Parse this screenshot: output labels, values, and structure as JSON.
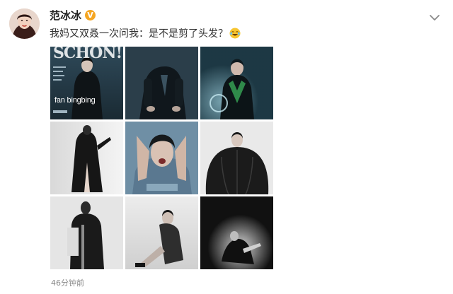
{
  "post": {
    "username": "范冰冰",
    "verified_badge": "V",
    "text": "我妈又双叒一次问我：是不是剪了头发？",
    "emoji_icon": "laughing-tears-emoji",
    "timestamp": "46分钟前"
  },
  "photos": {
    "cover": {
      "masthead": "SCHÖN!",
      "name": "fan bingbing"
    },
    "count": 9
  },
  "colors": {
    "badge": "#f5a623",
    "text": "#333333",
    "muted": "#888888"
  }
}
